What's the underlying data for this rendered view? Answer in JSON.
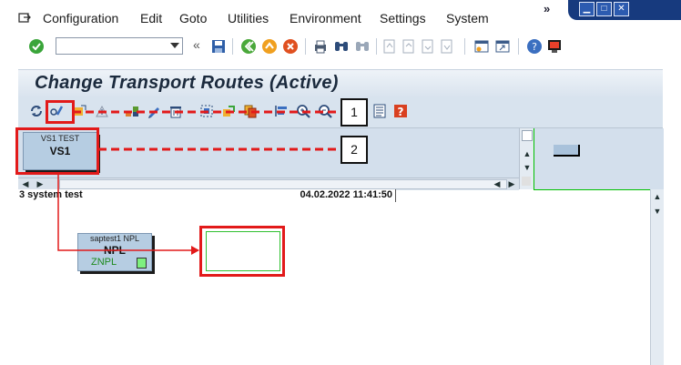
{
  "menubar": {
    "items": [
      {
        "label": "Configuration"
      },
      {
        "label": "Edit"
      },
      {
        "label": "Goto"
      },
      {
        "label": "Utilities"
      },
      {
        "label": "Environment"
      },
      {
        "label": "Settings"
      },
      {
        "label": "System"
      }
    ],
    "overflow_label": "»"
  },
  "toolbar": {
    "command_field_value": "",
    "back_arrows": "«"
  },
  "page": {
    "title": "Change Transport Routes (Active)"
  },
  "graphic": {
    "systems": [
      {
        "id": "vs1",
        "description": "VS1 TEST",
        "name": "VS1"
      },
      {
        "id": "npl",
        "description": "saptest1 NPL",
        "name": "NPL",
        "client": "ZNPL"
      }
    ],
    "status_left": "3 system test",
    "status_right": "04.02.2022 11:41:50"
  },
  "callouts": [
    "1",
    "2"
  ],
  "colors": {
    "accent_red": "#e21a1a",
    "canvas_blue": "#d3dfec",
    "system_box": "#b6cde2",
    "group_green": "#30c030"
  }
}
